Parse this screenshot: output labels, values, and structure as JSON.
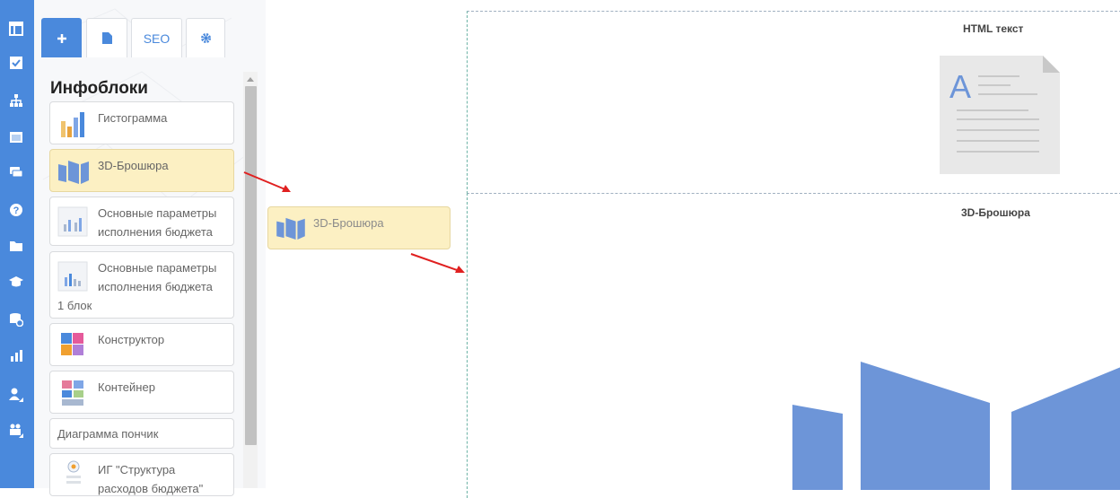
{
  "tabs": [
    {
      "icon": "plus-icon"
    },
    {
      "icon": "file-icon"
    },
    {
      "label": "SEO"
    },
    {
      "icon": "gear-icon"
    }
  ],
  "panel_title": "Инфоблоки",
  "items": [
    {
      "label": "Гистограмма",
      "icon": "histogram-icon"
    },
    {
      "label": "3D-Брошюра",
      "icon": "brochure-icon"
    },
    {
      "label_lines": [
        "Основные параметры",
        "исполнения бюджета"
      ],
      "icon": "chart-thumbnail-icon"
    },
    {
      "label_lines": [
        "Основные параметры",
        "исполнения бюджета"
      ],
      "label_extra": "1 блок",
      "icon": "chart-thumbnail-icon"
    },
    {
      "label": "Конструктор",
      "icon": "puzzle-icon"
    },
    {
      "label": "Контейнер",
      "icon": "container-icon"
    },
    {
      "label": "Диаграмма пончик"
    },
    {
      "label_lines": [
        "ИГ \"Структура",
        "расходов бюджета\""
      ],
      "icon": "infographic-icon"
    }
  ],
  "dragged_item": {
    "label": "3D-Брошюра",
    "icon": "brochure-icon"
  },
  "blocks": [
    {
      "title": "HTML текст",
      "icon": "document-icon"
    },
    {
      "title": "3D-Брошюра",
      "icon": "brochure-icon"
    }
  ],
  "rail_icons": [
    "table-icon",
    "checklist-icon",
    "sitemap-icon",
    "calendar-icon",
    "comments-icon",
    "help-icon",
    "folder-icon",
    "graduation-icon",
    "database-settings-icon",
    "chart-icon",
    "user-settings-icon",
    "users-icon"
  ],
  "colors": {
    "accent": "#4a89dc",
    "highlight": "#fcf0c3",
    "arrow": "#e02020"
  }
}
